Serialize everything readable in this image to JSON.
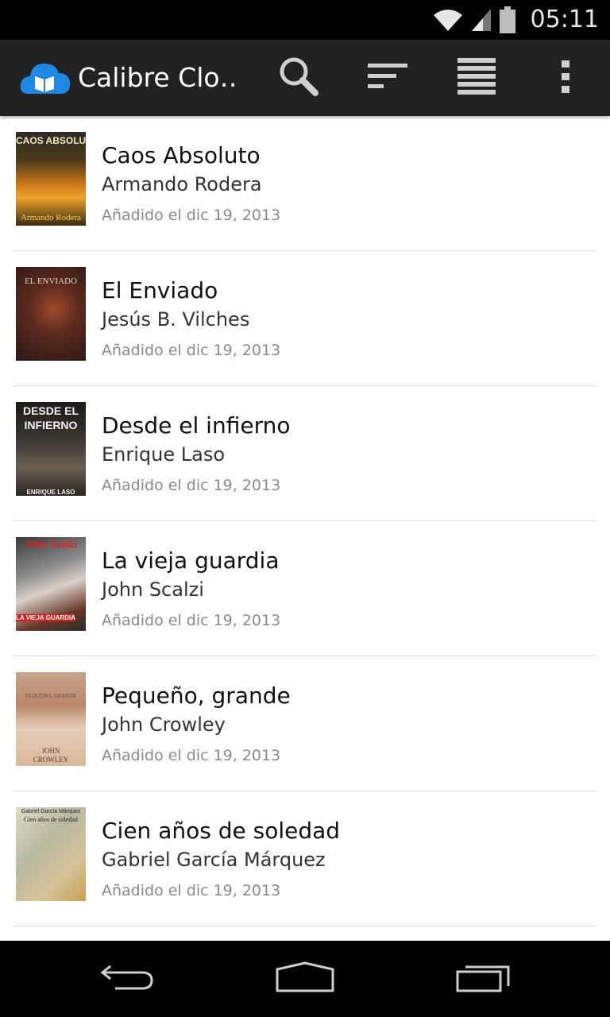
{
  "status_bar": {
    "time": "05:11",
    "icons": [
      "wifi-icon",
      "signal-icon",
      "battery-icon"
    ]
  },
  "action_bar": {
    "title": "Calibre Clo…",
    "actions": [
      "search-icon",
      "sort-icon",
      "list-view-icon",
      "overflow-menu-icon"
    ]
  },
  "books": [
    {
      "title": "Caos Absoluto",
      "author": "Armando Rodera",
      "added": "Añadido el dic 19, 2013",
      "cover_text_top": "CAOS ABSOLUTO",
      "cover_text_bottom": "Armando Rodera"
    },
    {
      "title": "El Enviado",
      "author": "Jesús B. Vilches",
      "added": "Añadido el dic 19, 2013",
      "cover_text_top": "EL ENVIADO",
      "cover_text_bottom": ""
    },
    {
      "title": "Desde el infierno",
      "author": "Enrique Laso",
      "added": "Añadido el dic 19, 2013",
      "cover_text_top": "DESDE EL INFIERNO",
      "cover_text_bottom": "ENRIQUE LASO"
    },
    {
      "title": "La vieja guardia",
      "author": "John Scalzi",
      "added": "Añadido el dic 19, 2013",
      "cover_text_top": "John Scalzi",
      "cover_text_bottom": "LA VIEJA GUARDIA"
    },
    {
      "title": "Pequeño, grande",
      "author": "John Crowley",
      "added": "Añadido el dic 19, 2013",
      "cover_text_top": "PEQUEÑO, GRANDE",
      "cover_text_bottom": "JOHN CROWLEY"
    },
    {
      "title": "Cien años de soledad",
      "author": "Gabriel García Márquez",
      "added": "Añadido el dic 19, 2013",
      "cover_text_top": "Gabriel García Márquez",
      "cover_text_bottom": "Cien años de soledad"
    }
  ],
  "nav_bar": {
    "buttons": [
      "back-icon",
      "home-icon",
      "recent-apps-icon"
    ]
  },
  "colors": {
    "status_bar": "#000000",
    "action_bar": "#222222",
    "app_icon": "#1e88e5",
    "divider": "#dddddd",
    "date_text": "#8a8a8a"
  }
}
